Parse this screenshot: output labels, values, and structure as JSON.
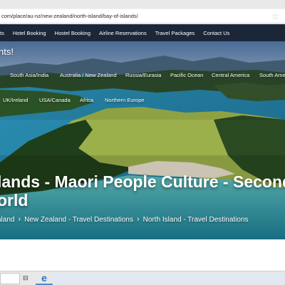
{
  "browser": {
    "url": "com/place/au-nz/new-zealand/north-island/bay-of-islands/"
  },
  "nav": {
    "items": [
      "ts",
      "Hotel Booking",
      "Hostel Booking",
      "Airline Reservations",
      "Travel Packages",
      "Contact Us"
    ]
  },
  "hero": {
    "tagline": "nts!",
    "regions_row1": [
      "",
      "South Asia/India",
      "Australia / New Zealand",
      "Russia/Eurasia",
      "Pacific Ocean",
      "Central America",
      "South Ame"
    ],
    "regions_row2": [
      "",
      "UK/Ireland",
      "USA/Canada",
      "Africa",
      "Northern Europe"
    ],
    "title_line1": "lands - Maori People Culture - Second",
    "title_line2": "orld",
    "breadcrumb": [
      "aland",
      "New Zealand - Travel Destinations",
      "North Island - Travel Destinations"
    ]
  },
  "colors": {
    "nav_bg": "#1b2738",
    "sky": "#5e7ea8",
    "sea": "#2f93b4",
    "grass": "#9bb04a",
    "forest": "#1f3f1a",
    "beach": "#e8dfcc"
  },
  "icons": {
    "favorite": "star-icon",
    "task_view": "task-view-icon",
    "browser": "edge-icon"
  }
}
